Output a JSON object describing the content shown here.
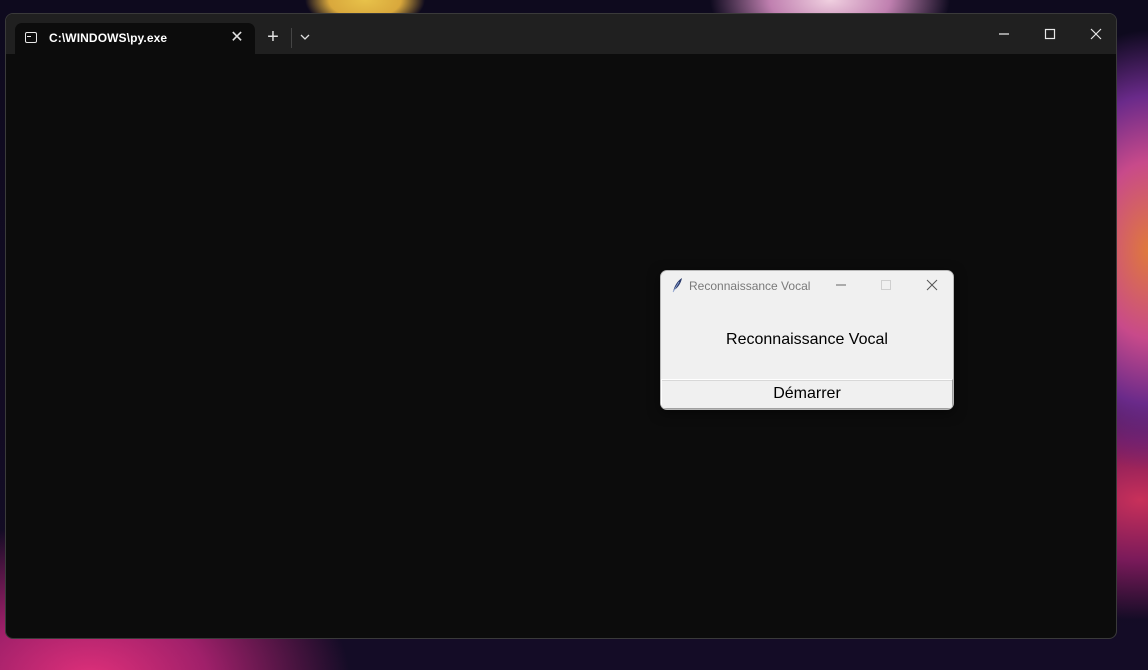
{
  "terminal": {
    "tab_title": "C:\\WINDOWS\\py.exe",
    "tab_close_glyph": "✕",
    "new_tab_glyph": "+",
    "icons": {
      "tab": "terminal-icon",
      "dropdown": "chevron-down-icon",
      "minimize": "minimize-icon",
      "maximize": "maximize-icon",
      "close": "close-icon"
    }
  },
  "dialog": {
    "window_title": "Reconnaissance Vocal",
    "label": "Reconnaissance Vocal",
    "button_label": "Démarrer",
    "icons": {
      "app": "tk-feather-icon",
      "minimize": "minimize-icon",
      "maximize": "maximize-icon",
      "close": "close-icon"
    }
  }
}
